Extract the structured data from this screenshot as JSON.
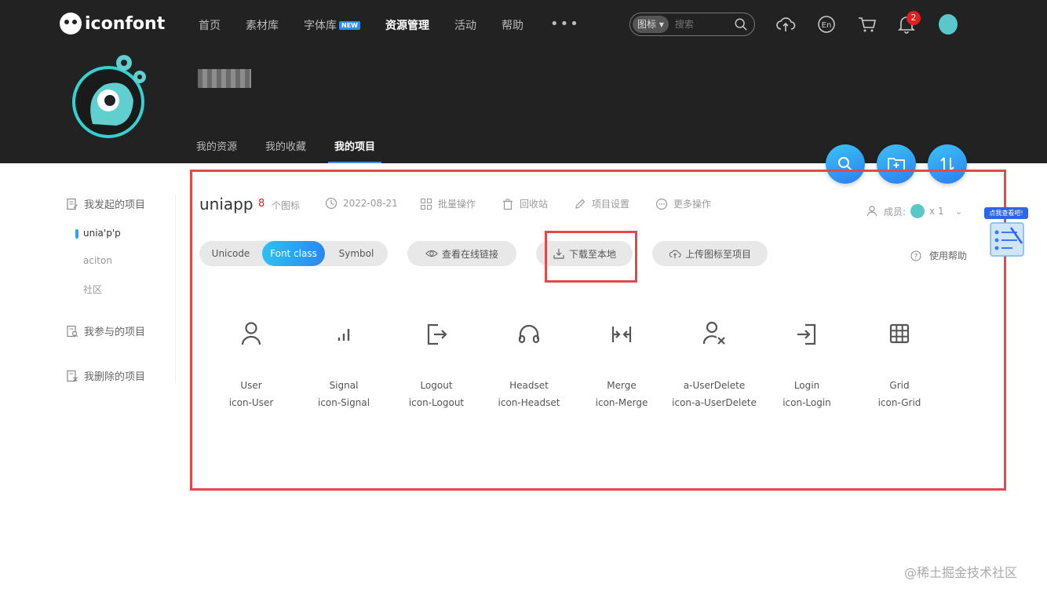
{
  "header": {
    "logo_text": "iconfont",
    "nav": [
      {
        "label": "首页",
        "active": false
      },
      {
        "label": "素材库",
        "active": false
      },
      {
        "label": "字体库",
        "active": false,
        "badge": "NEW"
      },
      {
        "label": "资源管理",
        "active": true
      },
      {
        "label": "活动",
        "active": false
      },
      {
        "label": "帮助",
        "active": false
      }
    ],
    "more": "•••",
    "search": {
      "type": "图标",
      "placeholder": "搜索"
    },
    "notification_count": "2",
    "lang": "En"
  },
  "profile": {
    "subtabs": [
      {
        "label": "我的资源",
        "active": false
      },
      {
        "label": "我的收藏",
        "active": false
      },
      {
        "label": "我的项目",
        "active": true
      }
    ]
  },
  "sidebar": {
    "group1": "我发起的项目",
    "items": [
      {
        "label": "unia'p'p",
        "active": true
      },
      {
        "label": "aciton",
        "active": false
      },
      {
        "label": "社区",
        "active": false
      }
    ],
    "group2": "我参与的项目",
    "group3": "我删除的项目"
  },
  "project": {
    "name": "uniapp",
    "count": "8",
    "count_label": "个图标",
    "date": "2022-08-21",
    "batch": "批量操作",
    "recycle": "回收站",
    "settings": "项目设置",
    "more": "更多操作",
    "members_label": "成员:",
    "members_count": "x 1"
  },
  "toolbar": {
    "tabs": [
      "Unicode",
      "Font class",
      "Symbol"
    ],
    "active_tab": "Font class",
    "view_online": "查看在线链接",
    "download": "下载至本地",
    "upload": "上传图标至项目",
    "help": "使用帮助"
  },
  "icons": [
    {
      "name": "User",
      "class": "icon-User",
      "glyph": "user-icon"
    },
    {
      "name": "Signal",
      "class": "icon-Signal",
      "glyph": "signal-icon"
    },
    {
      "name": "Logout",
      "class": "icon-Logout",
      "glyph": "logout-icon"
    },
    {
      "name": "Headset",
      "class": "icon-Headset",
      "glyph": "headset-icon"
    },
    {
      "name": "Merge",
      "class": "icon-Merge",
      "glyph": "merge-icon"
    },
    {
      "name": "a-UserDelete",
      "class": "icon-a-UserDelete",
      "glyph": "user-delete-icon"
    },
    {
      "name": "Login",
      "class": "icon-Login",
      "glyph": "login-icon"
    },
    {
      "name": "Grid",
      "class": "icon-Grid",
      "glyph": "grid-icon"
    }
  ],
  "widget_label": "点我查看吧!",
  "watermark": "@稀土掘金技术社区",
  "colors": {
    "accent": "#2a88ef",
    "highlight": "#e24a4a",
    "header_bg": "#222222"
  }
}
